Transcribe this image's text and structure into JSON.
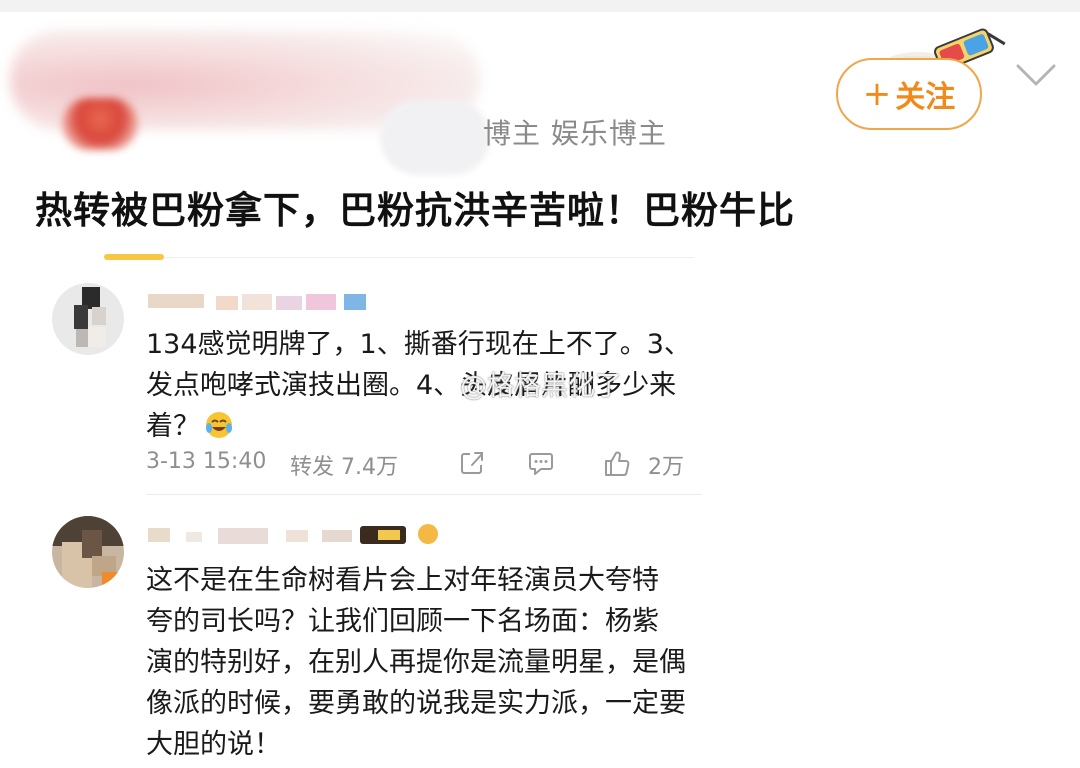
{
  "post": {
    "blogger_tag": "博主 娱乐博主",
    "follow_label": "关注",
    "follow_plus": "+",
    "title": "热转被巴粉拿下，巴粉抗洪辛苦啦！巴粉牛比"
  },
  "comments": [
    {
      "lines": [
        "134感觉明牌了，1、撕番行现在上不了。3、",
        "发点咆哮式演技出圈。4、头皮屑片酬多少来",
        "着？"
      ],
      "emoji": "crying-laughing-emoji",
      "time": "3-13 15:40",
      "repost": "转发 7.4万",
      "likes": "2万"
    },
    {
      "lines": [
        "这不是在生命树看片会上对年轻演员大夸特",
        "夸的司长吗？让我们回顾一下名场面：杨紫",
        "演的特别好，在别人再提你是流量明星，是偶",
        "像派的时候，要勇敢的说我是实力派，一定要",
        "大胆的说！"
      ]
    }
  ],
  "watermark": "@格格黑化了",
  "colors": {
    "accent": "#f28a1a",
    "follow_border": "#f0a64a",
    "meta_text": "#8f8f8f",
    "card_accent": "#f7c744"
  },
  "icons": {
    "share": "share-icon",
    "comment": "comment-icon",
    "like": "thumbs-up-icon",
    "more": "chevron-down-icon"
  }
}
